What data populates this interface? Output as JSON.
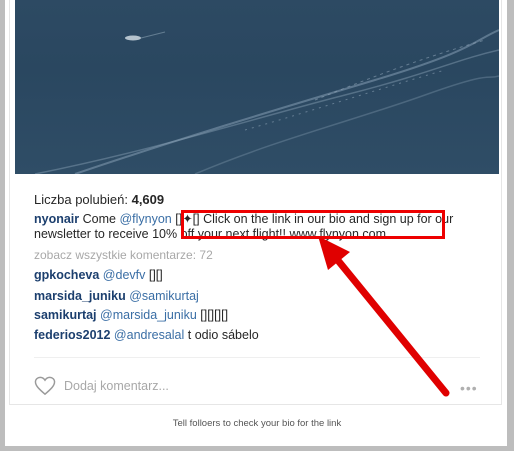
{
  "post": {
    "likes_label": "Liczba polubień:",
    "likes_count": "4,609",
    "caption_user": "nyonair",
    "caption_pre": "Come",
    "caption_mention": "@flynyon",
    "caption_emoji": "[]✦[]",
    "caption_text": "Click on the link in our bio and sign up for our newsletter to receive 10% off your next flight!! www.flynyon.com",
    "view_all": "zobacz wszystkie komentarze: 72",
    "comments": [
      {
        "user": "gpkocheva",
        "mention": "@devfv",
        "text": "[][]"
      },
      {
        "user": "marsida_juniku",
        "mention": "@samikurtaj",
        "text": ""
      },
      {
        "user": "samikurtaj",
        "mention": "@marsida_juniku",
        "text": "[][][][]"
      },
      {
        "user": "federios2012",
        "mention": "@andresalal",
        "text": "t odio sábelo"
      }
    ],
    "add_comment_placeholder": "Dodaj komentarz...",
    "more_label": "•••"
  },
  "footer_caption": "Tell folloers to check your bio for the link",
  "colors": {
    "annotation": "#e00000",
    "username": "#1c3f6e",
    "mention": "#3a6ea5"
  },
  "icons": [
    "heart-icon",
    "more-options-icon"
  ]
}
